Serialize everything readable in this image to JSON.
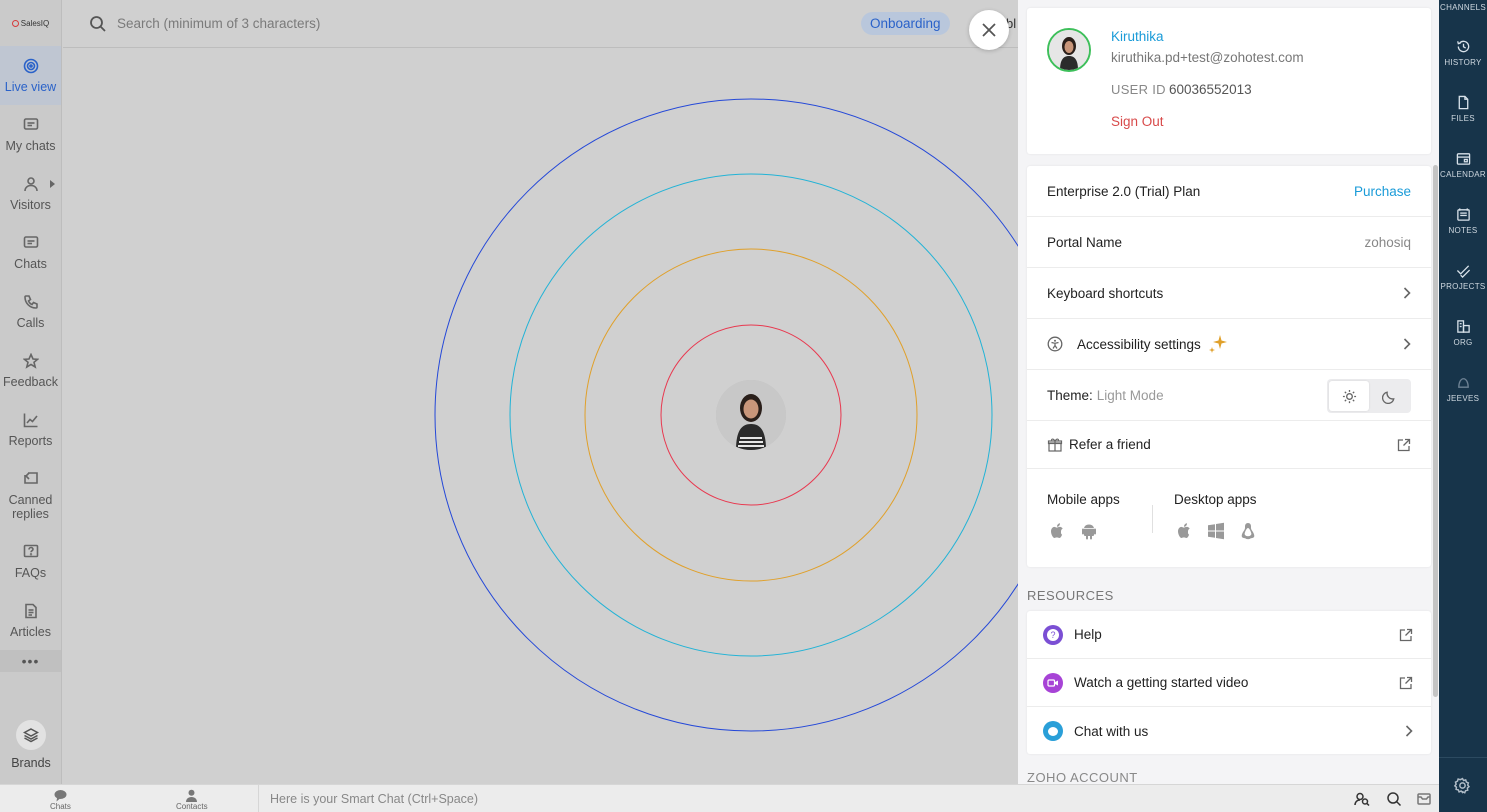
{
  "app": {
    "logo_text": "SalesIQ"
  },
  "sidebar": {
    "items": [
      {
        "label": "Live view",
        "icon": "radar-icon"
      },
      {
        "label": "My chats",
        "icon": "chat-bubble-icon"
      },
      {
        "label": "Visitors",
        "icon": "person-icon"
      },
      {
        "label": "Chats",
        "icon": "chat-bubble-icon"
      },
      {
        "label": "Calls",
        "icon": "phone-icon"
      },
      {
        "label": "Feedback",
        "icon": "star-icon"
      },
      {
        "label": "Reports",
        "icon": "chart-icon"
      },
      {
        "label": "Canned replies",
        "icon": "canned-icon"
      },
      {
        "label": "FAQs",
        "icon": "question-icon"
      },
      {
        "label": "Articles",
        "icon": "document-icon"
      }
    ],
    "more": "•••",
    "brands_label": "Brands"
  },
  "topbar": {
    "search_placeholder": "Search (minimum of 3 characters)",
    "onboarding_label": "Onboarding",
    "truncated_text": "bl"
  },
  "profile": {
    "name": "Kiruthika",
    "email": "kiruthika.pd+test@zohotest.com",
    "user_id_label": "USER ID",
    "user_id": "60036552013",
    "sign_out": "Sign Out"
  },
  "settings": {
    "plan_label": "Enterprise 2.0 (Trial) Plan",
    "purchase_label": "Purchase",
    "portal_label": "Portal Name",
    "portal_value": "zohosiq",
    "keyboard_label": "Keyboard shortcuts",
    "accessibility_label": "Accessibility settings",
    "theme_label": "Theme:",
    "theme_value": "Light Mode",
    "refer_label": "Refer a friend",
    "mobile_apps_label": "Mobile apps",
    "desktop_apps_label": "Desktop apps"
  },
  "resources": {
    "section_label": "RESOURCES",
    "items": [
      {
        "label": "Help",
        "color": "#7b4fd4"
      },
      {
        "label": "Watch a getting started video",
        "color": "#a743d6"
      },
      {
        "label": "Chat with us",
        "color": "#2a9fd8"
      }
    ],
    "next_section_label": "ZOHO ACCOUNT"
  },
  "right_rail": {
    "items": [
      {
        "label": "CHANNELS",
        "icon": "channel-icon"
      },
      {
        "label": "HISTORY",
        "icon": "history-icon"
      },
      {
        "label": "FILES",
        "icon": "file-icon"
      },
      {
        "label": "CALENDAR",
        "icon": "calendar-icon"
      },
      {
        "label": "NOTES",
        "icon": "notes-icon"
      },
      {
        "label": "PROJECTS",
        "icon": "check-icon"
      },
      {
        "label": "ORG",
        "icon": "org-icon"
      },
      {
        "label": "JEEVES",
        "icon": "jeeves-icon"
      }
    ]
  },
  "bottombar": {
    "chats_label": "Chats",
    "contacts_label": "Contacts",
    "smart_chat_placeholder": "Here is your Smart Chat (Ctrl+Space)"
  },
  "colors": {
    "accent": "#2a62c9",
    "link": "#1a9bd8",
    "danger": "#d84a4a",
    "ring_outer": "#2448d8",
    "ring_2": "#22b3d6",
    "ring_3": "#e0a02a",
    "ring_inner": "#e8384f",
    "rail_bg": "#17344a"
  }
}
